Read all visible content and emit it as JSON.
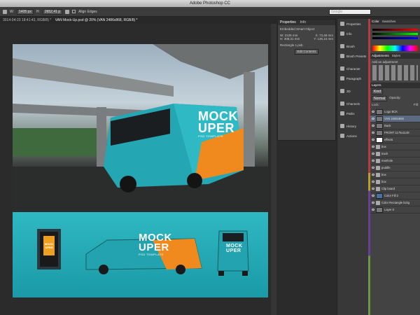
{
  "app": {
    "title": "Adobe Photoshop CC"
  },
  "options": {
    "w_label": "W:",
    "w_value": "1405 px",
    "h_label": "H:",
    "h_value": "2652,41 p",
    "align_edges": "Align Edges"
  },
  "search": {
    "placeholder": "Google"
  },
  "tab": {
    "label": "3014-04-23 18:41:43, RGB/8) *",
    "doc": "VAN Mock-Up.psd @ 20% (VAN 2486x868, RGB/8) *"
  },
  "mockup": {
    "line1": "MOCK",
    "line2": "UPER",
    "sub": "PSD TEMPLATE"
  },
  "properties": {
    "tab1": "Properties",
    "tab2": "Info",
    "smart": "Embedded Smart Object",
    "w": "W: 2126 mm",
    "x": "X: 73,48 mm",
    "h": "H: 308,31 mm",
    "y": "Y: 136,16 mm",
    "file": "Rectangle 1.psb",
    "edit_btn": "Edit Contents"
  },
  "iconpanel": {
    "items": [
      "Properties",
      "Info",
      "Brush",
      "Brush Presets",
      "Character",
      "Paragraph",
      "3D",
      "Channels",
      "Paths",
      "History",
      "Actions"
    ]
  },
  "color": {
    "tab1": "Color",
    "tab2": "Swatches"
  },
  "adjustments": {
    "tab1": "Adjustments",
    "tab2": "Styles",
    "add": "Add an adjustment"
  },
  "layers": {
    "tab": "Layers",
    "kind": "Kind",
    "mode": "Normal",
    "opacity_label": "Opacity:",
    "lock_label": "Lock:",
    "fill_label": "Fill:",
    "items": [
      "Logo BCK",
      "VAN 2486x868",
      "Back",
      "FRONT 1175x1148",
      "effects",
      "box",
      "track",
      "manhole",
      "puddle",
      "box",
      "box",
      "Clip board",
      "Color Fill 2",
      "Color Rectangle bckg",
      "Layer 0"
    ]
  },
  "colors": {
    "red": "#b13d42",
    "yellow": "#b8a02a",
    "purple": "#6a3d9a",
    "green": "#6a9a3d",
    "teal": "#22aab6"
  }
}
